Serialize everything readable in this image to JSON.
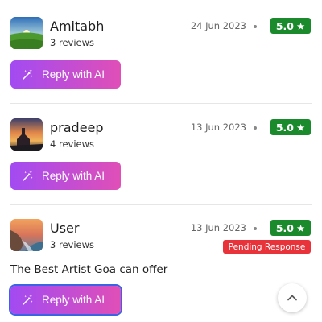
{
  "reviews": [
    {
      "name": "Amitabh",
      "review_count": "3 reviews",
      "date": "24 Jun 2023",
      "rating": "5.0",
      "reply_label": "Reply with AI",
      "avatar": "landscape-avatar"
    },
    {
      "name": "pradeep",
      "review_count": "4 reviews",
      "date": "13 Jun 2023",
      "rating": "5.0",
      "reply_label": "Reply with AI",
      "avatar": "sunset-avatar"
    },
    {
      "name": "User",
      "review_count": "3 reviews",
      "date": "13 Jun 2023",
      "rating": "5.0",
      "status": "Pending Response",
      "comment": "The Best Artist Goa can offer",
      "reply_label": "Reply with AI",
      "avatar": "coast-avatar"
    }
  ],
  "icons": {
    "star": "★",
    "reply": "magic-wand-icon",
    "scroll_top": "chevron-up-icon"
  },
  "colors": {
    "rating_bg": "#1a8a2c",
    "pending_bg": "#e8333b",
    "button_gradient_start": "#a24bf2",
    "button_gradient_end": "#e04fb7"
  }
}
